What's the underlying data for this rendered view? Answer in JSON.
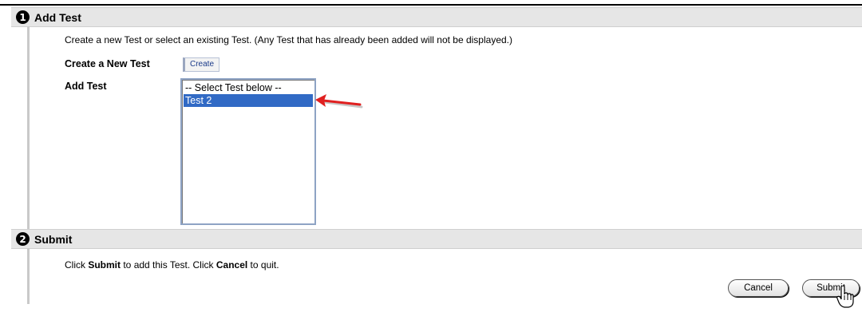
{
  "section1": {
    "step": "1",
    "title": "Add Test",
    "instructions": "Create a new Test or select an existing Test. (Any Test that has already been added will not be displayed.)",
    "create_label": "Create a New Test",
    "create_button": "Create",
    "add_label": "Add Test",
    "select_options": [
      "-- Select Test below --",
      "Test 2"
    ],
    "selected_option": "Test 2"
  },
  "section2": {
    "step": "2",
    "title": "Submit",
    "instr_part1": "Click ",
    "instr_submit": "Submit",
    "instr_part2": " to add this Test. Click ",
    "instr_cancel": "Cancel",
    "instr_part3": " to quit.",
    "cancel_button": "Cancel",
    "submit_button": "Submit"
  },
  "icons": {
    "annotation_arrow": "red-arrow-icon",
    "cursor": "hand-pointer-icon"
  },
  "colors": {
    "selection": "#316ac5",
    "arrow": "#e02020",
    "header_bg": "#e6e6e6"
  }
}
